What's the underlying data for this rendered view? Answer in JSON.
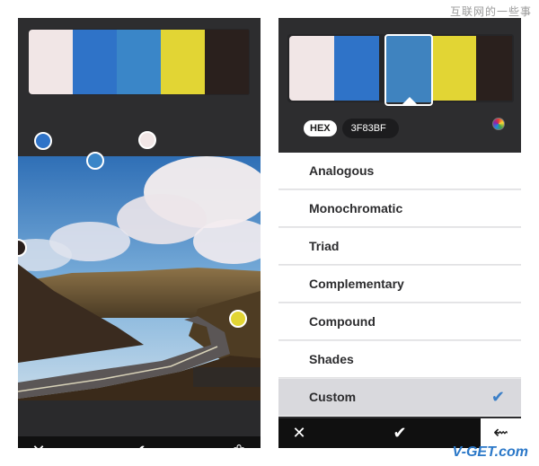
{
  "watermark": "互联网的一些事",
  "site_badge": "V-GET.com",
  "colors": {
    "swatch_1": "#f1e6e6",
    "swatch_2": "#2f73c8",
    "swatch_3": "#3a86c8",
    "swatch_4": "#e2d534",
    "swatch_5": "#2a201d"
  },
  "left_screen": {
    "palette": [
      {
        "color": "#f1e6e6"
      },
      {
        "color": "#2f73c8"
      },
      {
        "color": "#3a86c8"
      },
      {
        "color": "#e2d534"
      },
      {
        "color": "#2a201d"
      }
    ],
    "toolbar": {
      "cancel_icon": "close-icon",
      "confirm_icon": "checkmark-icon",
      "extra_icon": "flower-icon"
    }
  },
  "right_screen": {
    "palette_selected_index": 2,
    "hex_label": "HEX",
    "hex_value": "3F83BF",
    "color_wheel_icon": "color-wheel-icon",
    "schemes": [
      {
        "label": "Analogous"
      },
      {
        "label": "Monochromatic"
      },
      {
        "label": "Triad"
      },
      {
        "label": "Complementary"
      },
      {
        "label": "Compound"
      },
      {
        "label": "Shades"
      },
      {
        "label": "Custom",
        "selected": true
      }
    ],
    "toolbar": {
      "cancel_icon": "close-icon",
      "confirm_icon": "checkmark-icon",
      "back_icon": "back-arrow-icon"
    }
  }
}
